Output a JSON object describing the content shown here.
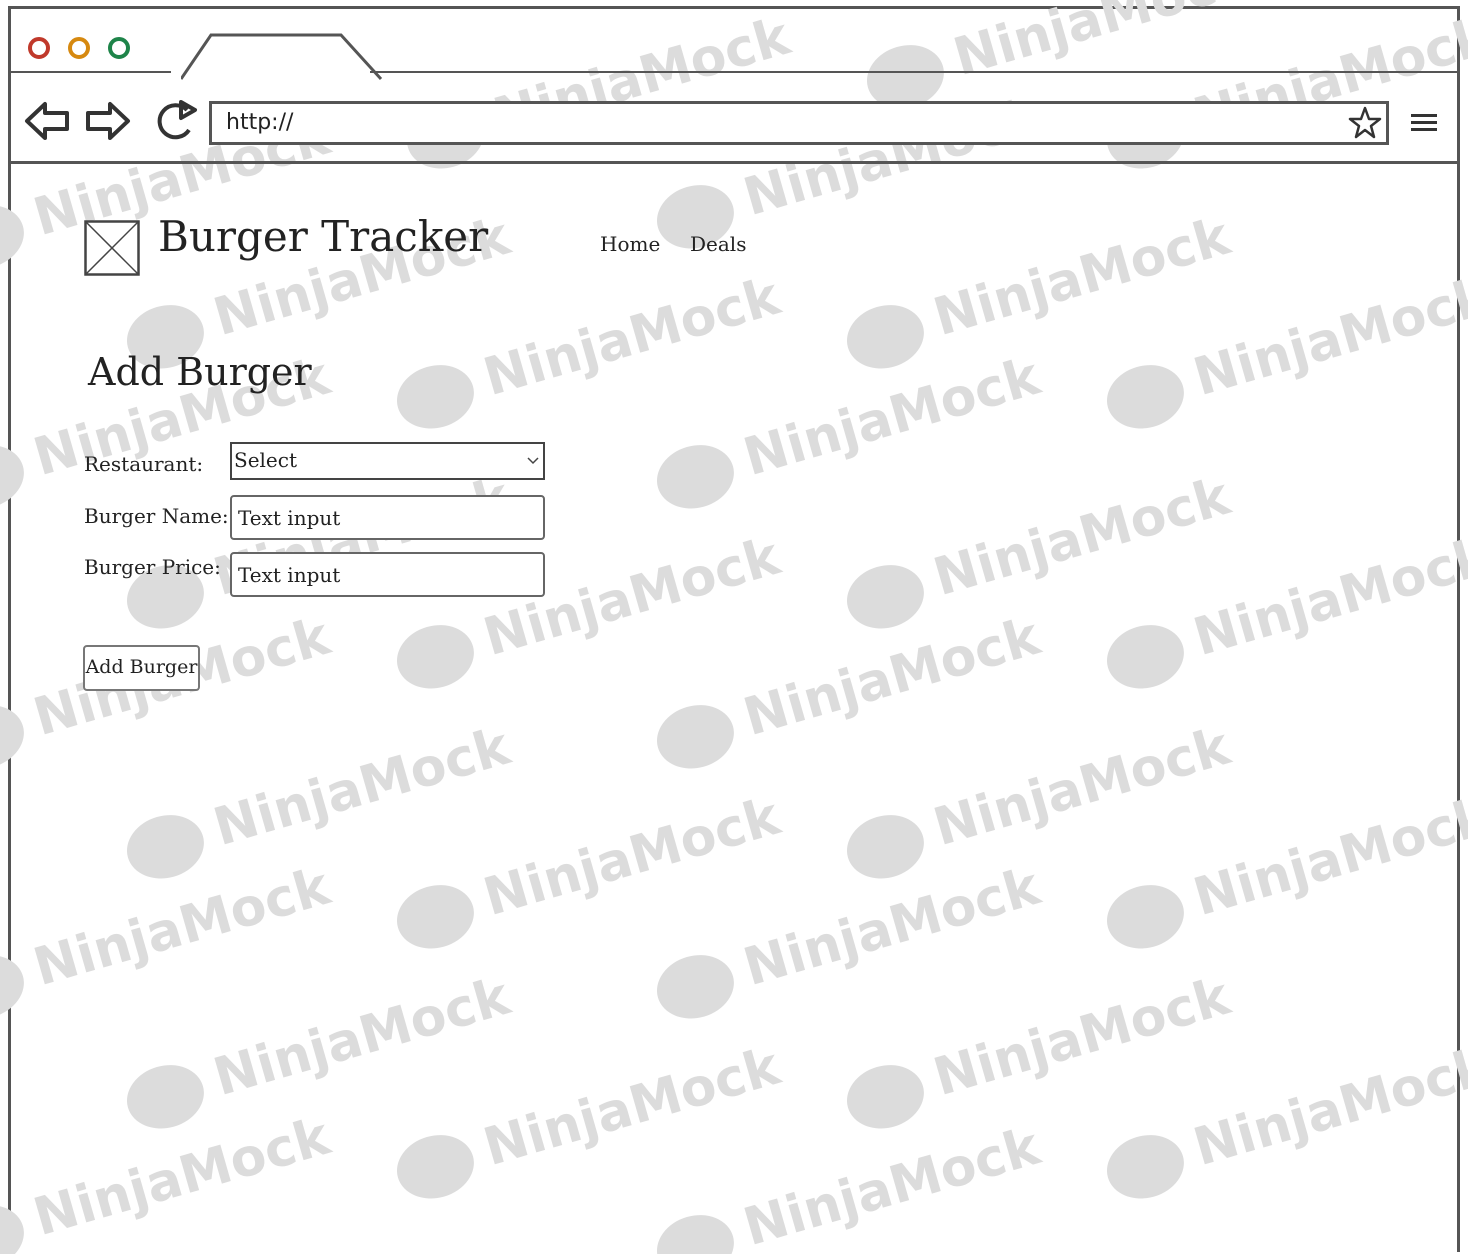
{
  "browser": {
    "address_bar": {
      "value": "http://"
    },
    "icons": {
      "back": "back-arrow-icon",
      "forward": "forward-arrow-icon",
      "reload": "reload-icon",
      "bookmark": "star-icon",
      "menu": "hamburger-menu-icon"
    },
    "traffic_lights": [
      "#c0392b",
      "#d68910",
      "#1e8449"
    ]
  },
  "header": {
    "brand": "Burger Tracker",
    "nav": [
      {
        "label": "Home"
      },
      {
        "label": "Deals"
      }
    ]
  },
  "form": {
    "title": "Add Burger",
    "restaurant": {
      "label": "Restaurant:",
      "value": "Select"
    },
    "burger_name": {
      "label": "Burger Name:",
      "placeholder": "Text input"
    },
    "burger_price": {
      "label": "Burger Price:",
      "placeholder": "Text input"
    },
    "submit_label": "Add Burger"
  },
  "watermark": "NinjaMock"
}
